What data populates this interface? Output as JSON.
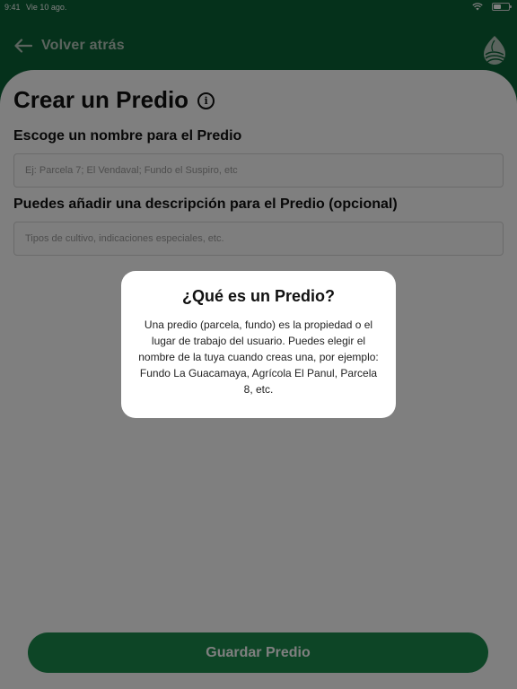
{
  "status_bar": {
    "time": "9:41",
    "date": "Vie 10 ago.",
    "battery": ""
  },
  "header": {
    "back_label": "Volver atrás",
    "logo_icon": "leaf-logo-icon"
  },
  "page": {
    "title": "Crear un Predio",
    "info_icon": "info-icon"
  },
  "form": {
    "name_label": "Escoge un nombre para el Predio",
    "name_placeholder": "Ej: Parcela 7; El Vendaval; Fundo el Suspiro, etc",
    "name_value": "",
    "description_label": "Puedes añadir una descripción para el Predio (opcional)",
    "description_placeholder": "Tipos de cultivo, indicaciones especiales, etc.",
    "description_value": ""
  },
  "save_button": {
    "label": "Guardar Predio"
  },
  "modal": {
    "title": "¿Qué es un Predio?",
    "body": "Una predio (parcela, fundo) es la propiedad o el lugar de trabajo del usuario. Puedes elegir el nombre de la tuya cuando creas una, por ejemplo: Fundo La Guacamaya, Agrícola El Panul, Parcela 8, etc."
  },
  "colors": {
    "brand_green": "#0b6236",
    "button_green": "#1a8a4c",
    "overlay": "rgba(0,0,0,0.5)"
  }
}
